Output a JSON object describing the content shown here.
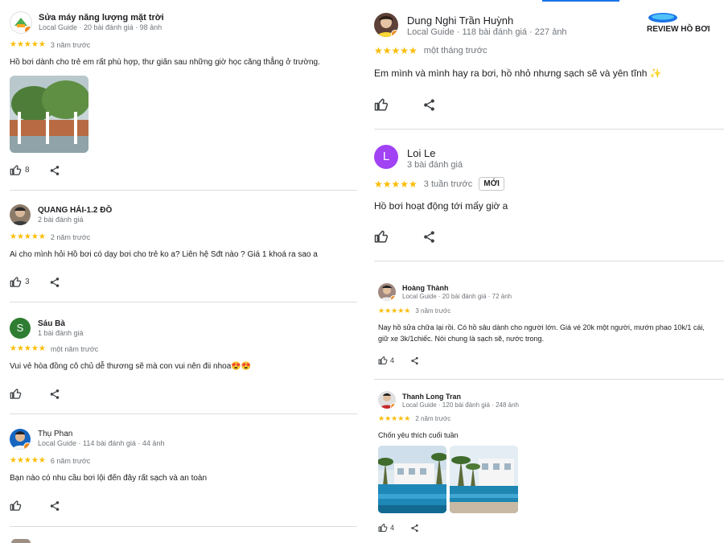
{
  "brand": {
    "text": "REVIEW HỒ BƠI",
    "accent": "#1a73e8"
  },
  "left": [
    {
      "name": "Sửa máy năng lượng mặt trời",
      "meta": "Local Guide · 20 bài đánh giá · 98 ảnh",
      "stars": "★★★★★",
      "ago": "3 năm trước",
      "text": "Hồ bơi dành cho trẻ em rất phù hợp, thư giãn sau những giờ học căng thẳng ở trường.",
      "likes": "8",
      "avatar_icon": "solar-logo-avatar"
    },
    {
      "name": "QUANG HẢI-1.2 ĐỒ",
      "meta": "2 bài đánh giá",
      "stars": "★★★★★",
      "ago": "2 năm trước",
      "text": "Ai cho mình hỏi Hồ bơi có dạy bơi cho trẻ ko a? Liên hệ Sđt nào ? Giá 1 khoá ra sao a",
      "likes": "3",
      "avatar_icon": "person-photo-avatar"
    },
    {
      "name": "Sáu Bà",
      "meta": "1 bài đánh giá",
      "stars": "★★★★★",
      "ago": "một năm trước",
      "text": "Vui vẻ hòa đồng cô chủ dễ thương sẽ mà con vui nên đii nhoa😍😍",
      "likes": "",
      "avatar_letter": "S",
      "avatar_color": "#2e7d32"
    },
    {
      "name": "Thụ Phan",
      "meta": "Local Guide · 114 bài đánh giá · 44 ảnh",
      "stars": "★★★★★",
      "ago": "6 năm trước",
      "text": "Bạn nào có nhu cầu bơi lội đến đây rất sạch và an toàn",
      "likes": "",
      "avatar_icon": "person-photo-avatar"
    }
  ],
  "right": [
    {
      "name": "Dung Nghi Trần Huỳnh",
      "meta": "Local Guide · 118 bài đánh giá · 227 ảnh",
      "stars": "★★★★★",
      "ago": "một tháng trước",
      "text": "Em mình và mình hay ra bơi, hồ nhỏ nhưng sạch sẽ và yên tĩnh ✨",
      "likes": ""
    },
    {
      "name": "Loi Le",
      "meta": "3 bài đánh giá",
      "stars": "★★★★★",
      "ago": "3 tuần trước",
      "badge": "MỚI",
      "text": "Hồ bơi hoạt động tới mấy giờ a",
      "likes": "",
      "avatar_letter": "L",
      "avatar_color": "#a142f4"
    },
    {
      "name": "Hoàng Thành",
      "meta": "Local Guide · 20 bài đánh giá · 72 ảnh",
      "stars": "★★★★★",
      "ago": "3 năm trước",
      "text1": "Nay hồ sửa chữa lại rồi. Có hồ sâu dành cho người lớn. Giá vé 20k một người, mướn phao 10k/1 cái,",
      "text2": "giữ xe 3k/1chiếc. Nói chung là sạch sẽ, nước trong.",
      "likes": "4"
    },
    {
      "name": "Thanh Long Tran",
      "meta": "Local Guide · 120 bài đánh giá · 248 ảnh",
      "stars": "★★★★★",
      "ago": "2 năm trước",
      "text": "Chốn yêu thích cuối tuần",
      "likes": "4"
    }
  ]
}
